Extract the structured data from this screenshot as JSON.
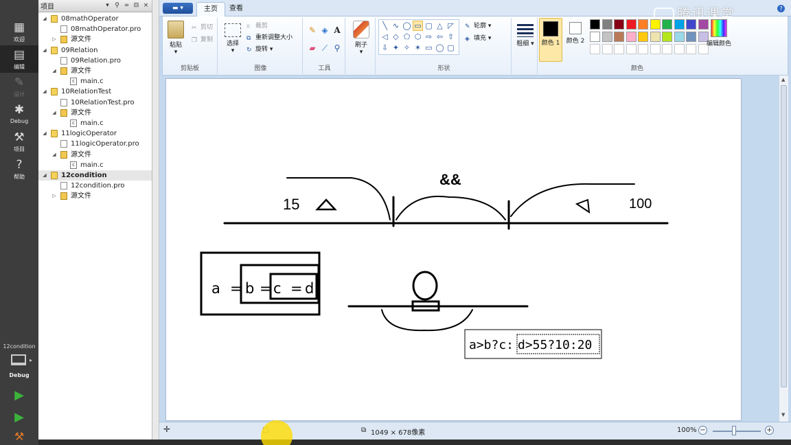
{
  "modebar": {
    "modes": [
      {
        "label": "欢迎",
        "icon": "grid-icon"
      },
      {
        "label": "编辑",
        "icon": "edit-icon"
      },
      {
        "label": "设计",
        "icon": "pencil-icon"
      },
      {
        "label": "Debug",
        "icon": "bug-icon"
      },
      {
        "label": "项目",
        "icon": "wrench-icon"
      },
      {
        "label": "帮助",
        "icon": "help-icon"
      }
    ],
    "kit_name": "12condition",
    "kit_mode": "Debug"
  },
  "project_panel": {
    "title": "项目",
    "items": [
      {
        "label": "08mathOperator",
        "level": 0,
        "type": "project",
        "expanded": true
      },
      {
        "label": "08mathOperator.pro",
        "level": 1,
        "type": "pro"
      },
      {
        "label": "源文件",
        "level": 1,
        "type": "src",
        "expanded": false
      },
      {
        "label": "09Relation",
        "level": 0,
        "type": "project",
        "expanded": true
      },
      {
        "label": "09Relation.pro",
        "level": 1,
        "type": "pro"
      },
      {
        "label": "源文件",
        "level": 1,
        "type": "src",
        "expanded": true
      },
      {
        "label": "main.c",
        "level": 2,
        "type": "c"
      },
      {
        "label": "10RelationTest",
        "level": 0,
        "type": "project",
        "expanded": true
      },
      {
        "label": "10RelationTest.pro",
        "level": 1,
        "type": "pro"
      },
      {
        "label": "源文件",
        "level": 1,
        "type": "src",
        "expanded": true
      },
      {
        "label": "main.c",
        "level": 2,
        "type": "c"
      },
      {
        "label": "11logicOperator",
        "level": 0,
        "type": "project",
        "expanded": true
      },
      {
        "label": "11logicOperator.pro",
        "level": 1,
        "type": "pro"
      },
      {
        "label": "源文件",
        "level": 1,
        "type": "src",
        "expanded": true
      },
      {
        "label": "main.c",
        "level": 2,
        "type": "c"
      },
      {
        "label": "12condition",
        "level": 0,
        "type": "project",
        "expanded": true,
        "selected": true
      },
      {
        "label": "12condition.pro",
        "level": 1,
        "type": "pro"
      },
      {
        "label": "源文件",
        "level": 1,
        "type": "src",
        "expanded": false
      }
    ]
  },
  "paint": {
    "watermark": "腾讯课堂",
    "tabs": {
      "home": "主页",
      "view": "查看"
    },
    "clipboard": {
      "paste": "粘贴",
      "cut": "剪切",
      "copy": "复制",
      "group": "剪贴板"
    },
    "image": {
      "select": "选择",
      "crop": "裁剪",
      "resize": "重新调整大小",
      "rotate": "旋转",
      "group": "图像"
    },
    "tools": {
      "group": "工具"
    },
    "brushes": {
      "label": "刷子"
    },
    "shapes": {
      "outline": "轮廓",
      "fill": "填充",
      "group": "形状"
    },
    "size": {
      "label": "粗细"
    },
    "colors": {
      "color1": "颜色 1",
      "color2": "颜色 2",
      "edit": "编辑颜色",
      "group": "颜色",
      "color1_value": "#000000",
      "color2_value": "#ffffff",
      "palette_row1": [
        "#000000",
        "#7f7f7f",
        "#880015",
        "#ed1c24",
        "#ff7f27",
        "#fff200",
        "#22b14c",
        "#00a2e8",
        "#3f48cc",
        "#a349a4"
      ],
      "palette_row2": [
        "#ffffff",
        "#c3c3c3",
        "#b97a57",
        "#ffaec9",
        "#ffc90e",
        "#efe4b0",
        "#b5e61d",
        "#99d9ea",
        "#7092be",
        "#c8bfe7"
      ]
    },
    "canvas": {
      "left_label": "15",
      "middle_label": "&&",
      "right_label": "100",
      "nested_a": "a",
      "nested_eq1": "=",
      "nested_b": "b",
      "nested_eq2": "=",
      "nested_c": "c",
      "nested_eq3": "=",
      "nested_d": "d",
      "ternary_prefix": "a>b?c:",
      "ternary_boxed": "d>55?10:20"
    },
    "status": {
      "dimensions": "1049 × 678像素",
      "zoom": "100%"
    }
  }
}
